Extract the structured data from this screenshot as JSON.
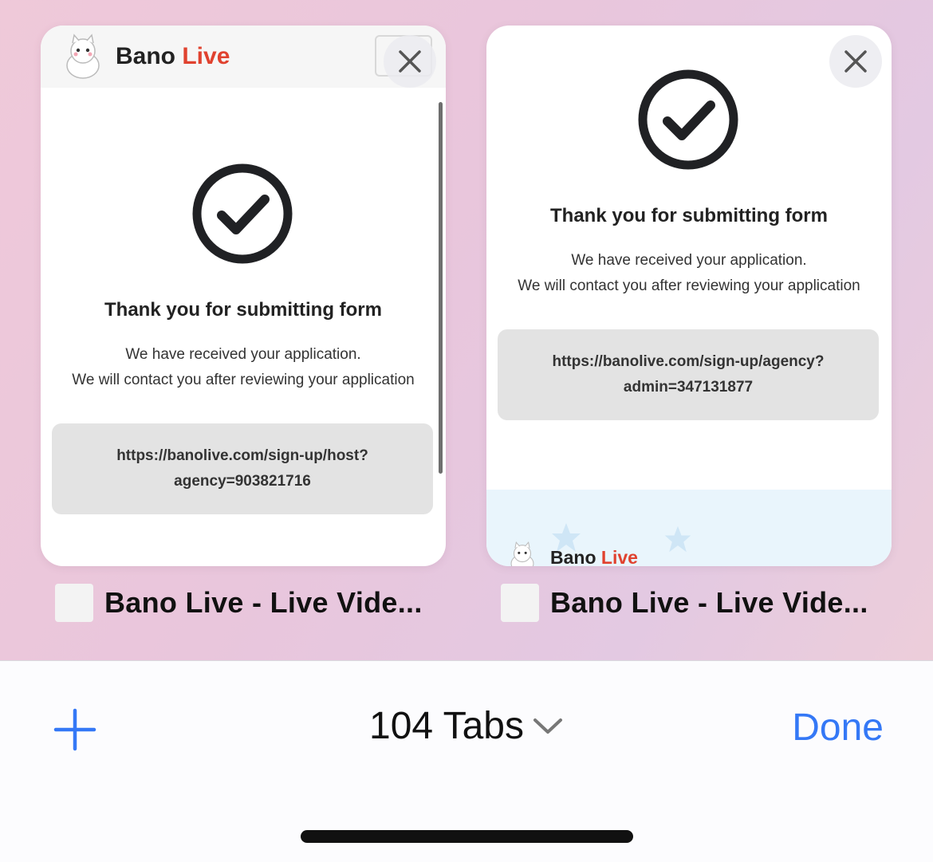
{
  "tabs": [
    {
      "site_name": "Bano",
      "site_name_accent": "Live",
      "heading": "Thank you for submitting form",
      "message_line1": "We have received your application.",
      "message_line2": "We will contact you after reviewing your application",
      "link_line1": "https://banolive.com/sign-up/host?",
      "link_line2": "agency=903821716",
      "tab_title": "Bano Live - Live Vide..."
    },
    {
      "heading": "Thank you for submitting form",
      "message_line1": "We have received your application.",
      "message_line2": "We will contact you after reviewing your application",
      "link_line1": "https://banolive.com/sign-up/agency?",
      "link_line2": "admin=347131877",
      "footer_name": "Bano",
      "footer_name_accent": "Live",
      "tab_title": "Bano Live - Live Vide..."
    }
  ],
  "toolbar": {
    "tab_count_label": "104 Tabs",
    "done_label": "Done",
    "new_tab_icon": "plus-icon",
    "accent_color": "#3478f6"
  }
}
